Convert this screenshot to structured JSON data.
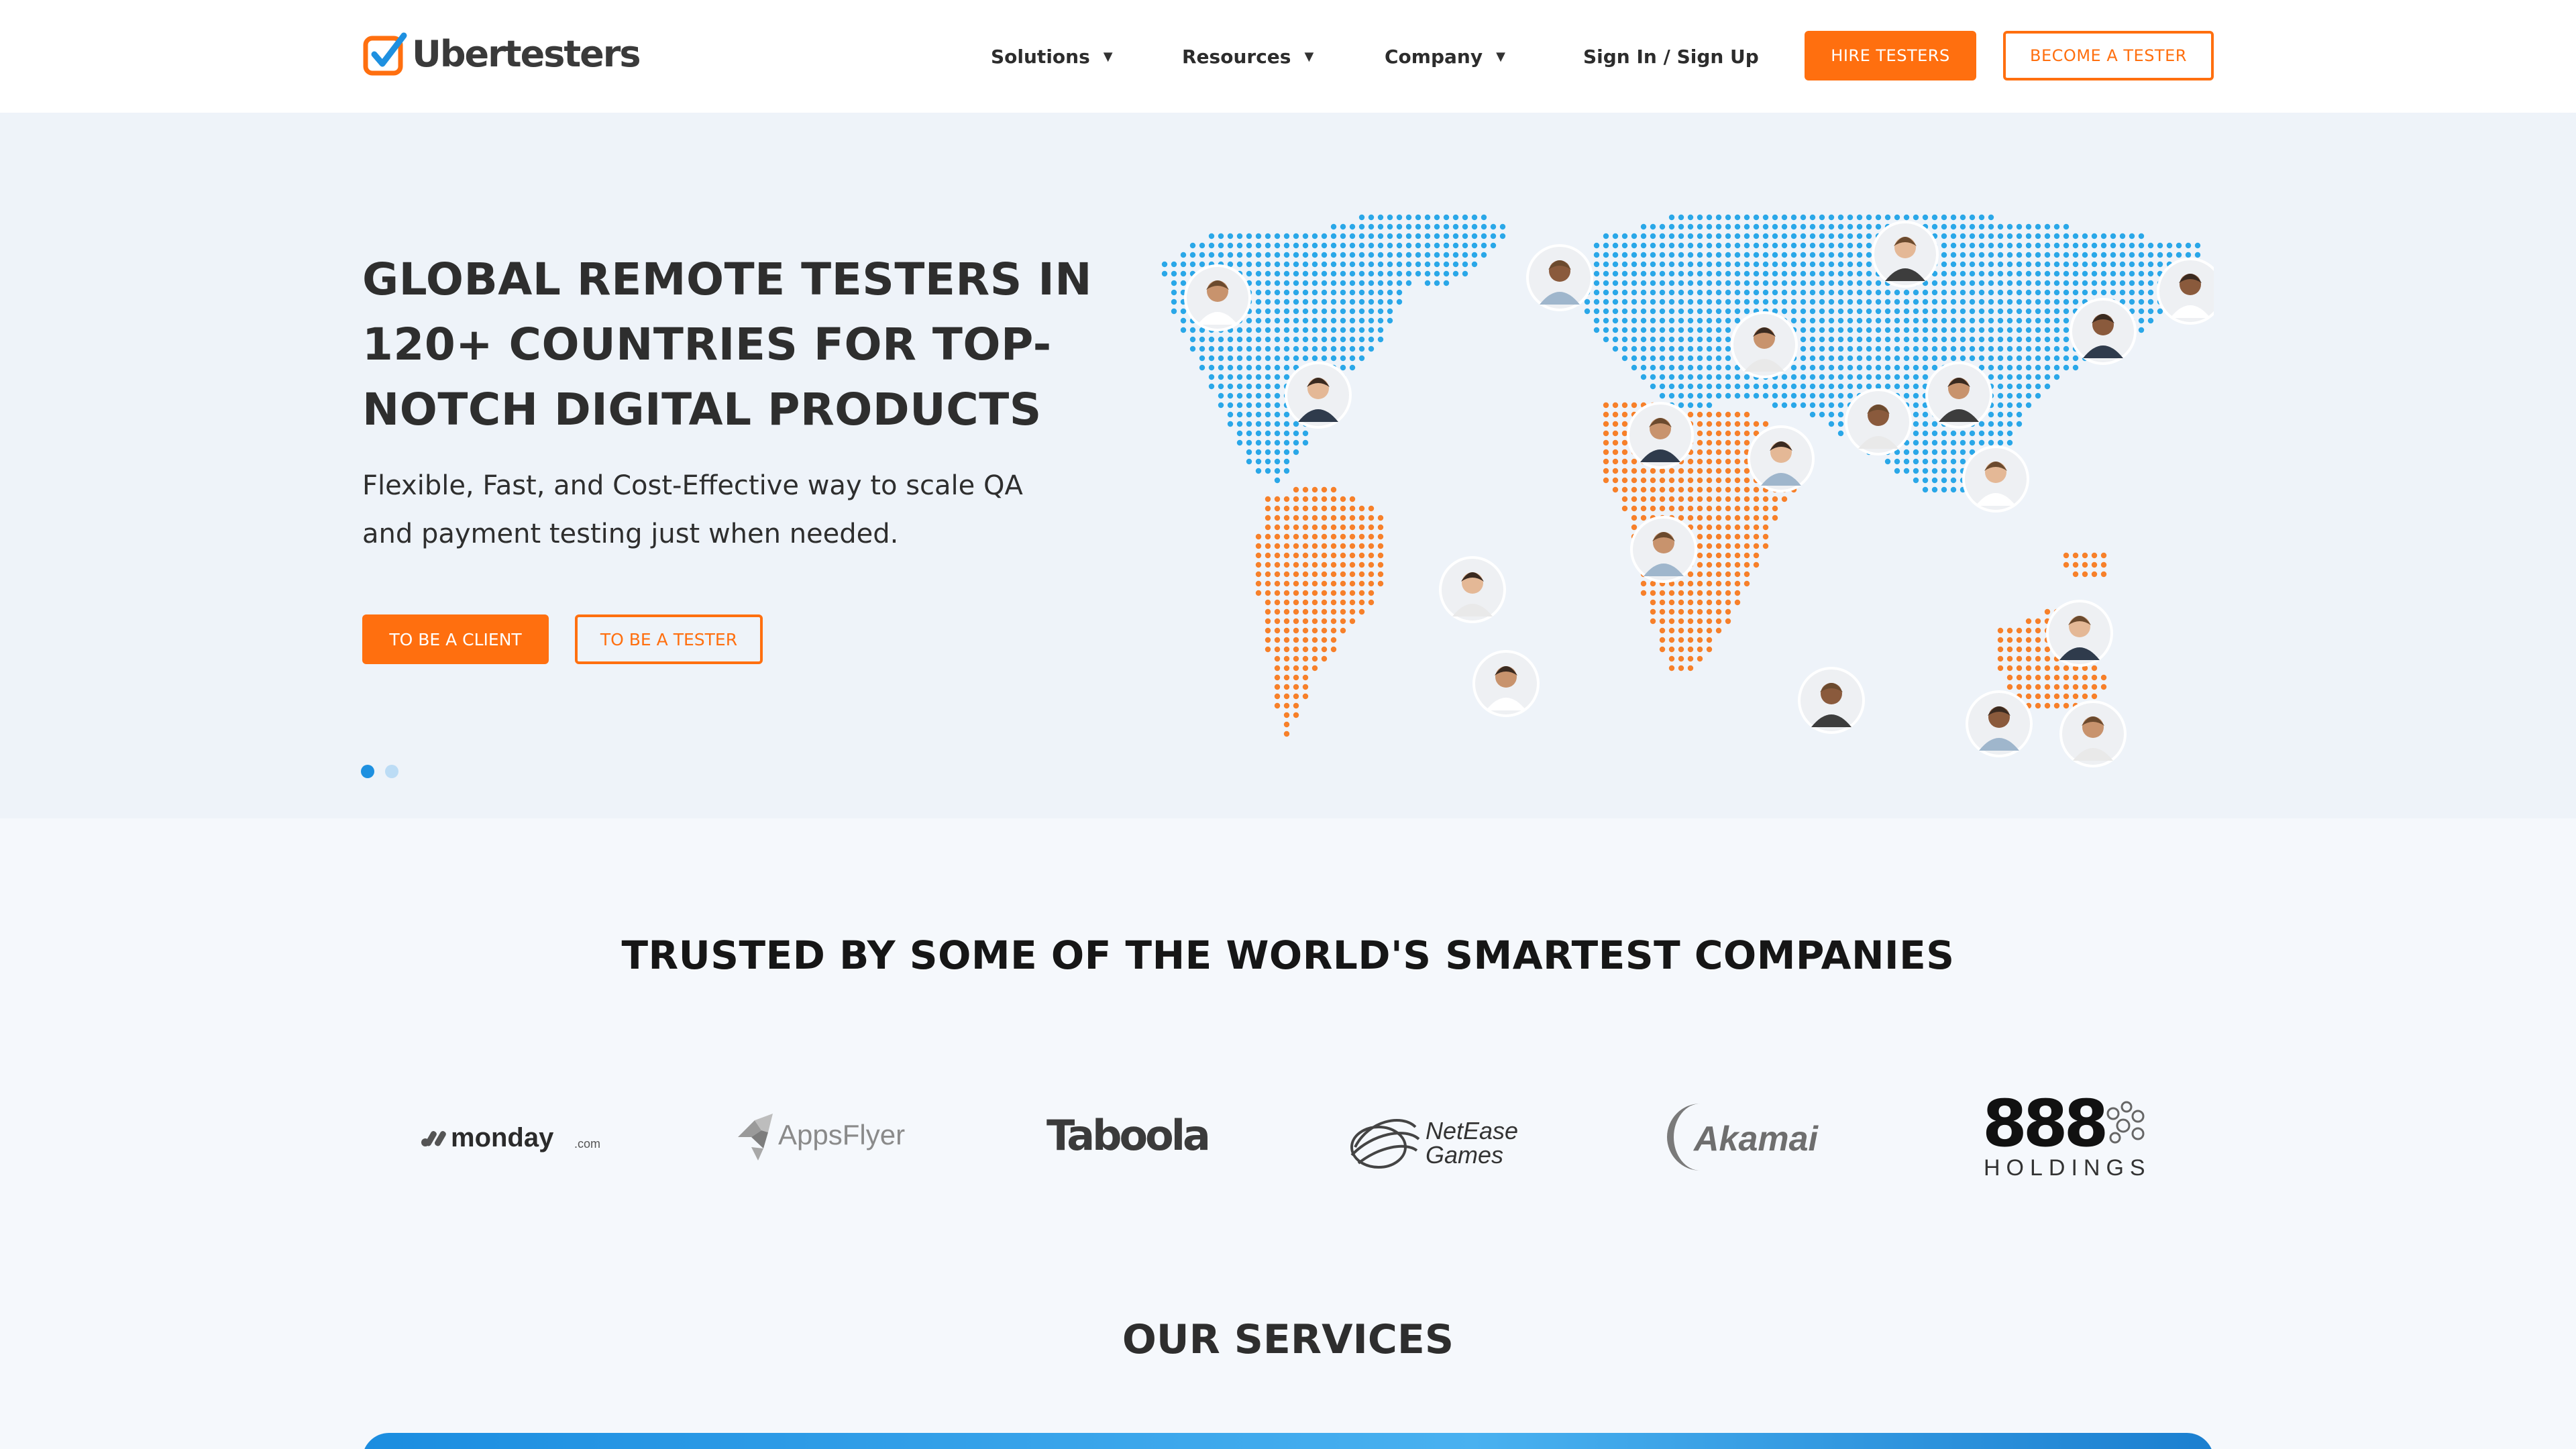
{
  "header": {
    "brand": "Ubertesters",
    "nav": [
      {
        "label": "Solutions",
        "has_dropdown": true
      },
      {
        "label": "Resources",
        "has_dropdown": true
      },
      {
        "label": "Company",
        "has_dropdown": true
      },
      {
        "label": "Sign In / Sign Up",
        "has_dropdown": false
      }
    ],
    "hire_label": "HIRE TESTERS",
    "become_label": "BECOME A TESTER"
  },
  "hero": {
    "title": "GLOBAL REMOTE TESTERS IN 120+ COUNTRIES FOR TOP-NOTCH DIGITAL PRODUCTS",
    "subtitle": "Flexible, Fast, and Cost-Effective way to scale QA and payment testing just when needed.",
    "client_button": "TO BE A CLIENT",
    "tester_button": "TO BE A TESTER",
    "carousel": {
      "total": 2,
      "active": 1
    }
  },
  "trusted": {
    "title": "TRUSTED BY SOME OF THE WORLD'S SMARTEST COMPANIES",
    "logos": [
      {
        "name": "monday",
        "suffix": ".com"
      },
      {
        "name": "AppsFlyer"
      },
      {
        "name": "Taboola"
      },
      {
        "name": "NetEase",
        "line2": "Games"
      },
      {
        "name": "Akamai"
      },
      {
        "name": "888",
        "line2": "HOLDINGS"
      }
    ]
  },
  "services": {
    "title": "OUR SERVICES"
  },
  "colors": {
    "accent": "#ff6f0f",
    "map_blue": "#2aa7e8",
    "map_orange": "#f7802a",
    "hero_bg": "#eef3f9",
    "text": "#2e2e2e"
  }
}
